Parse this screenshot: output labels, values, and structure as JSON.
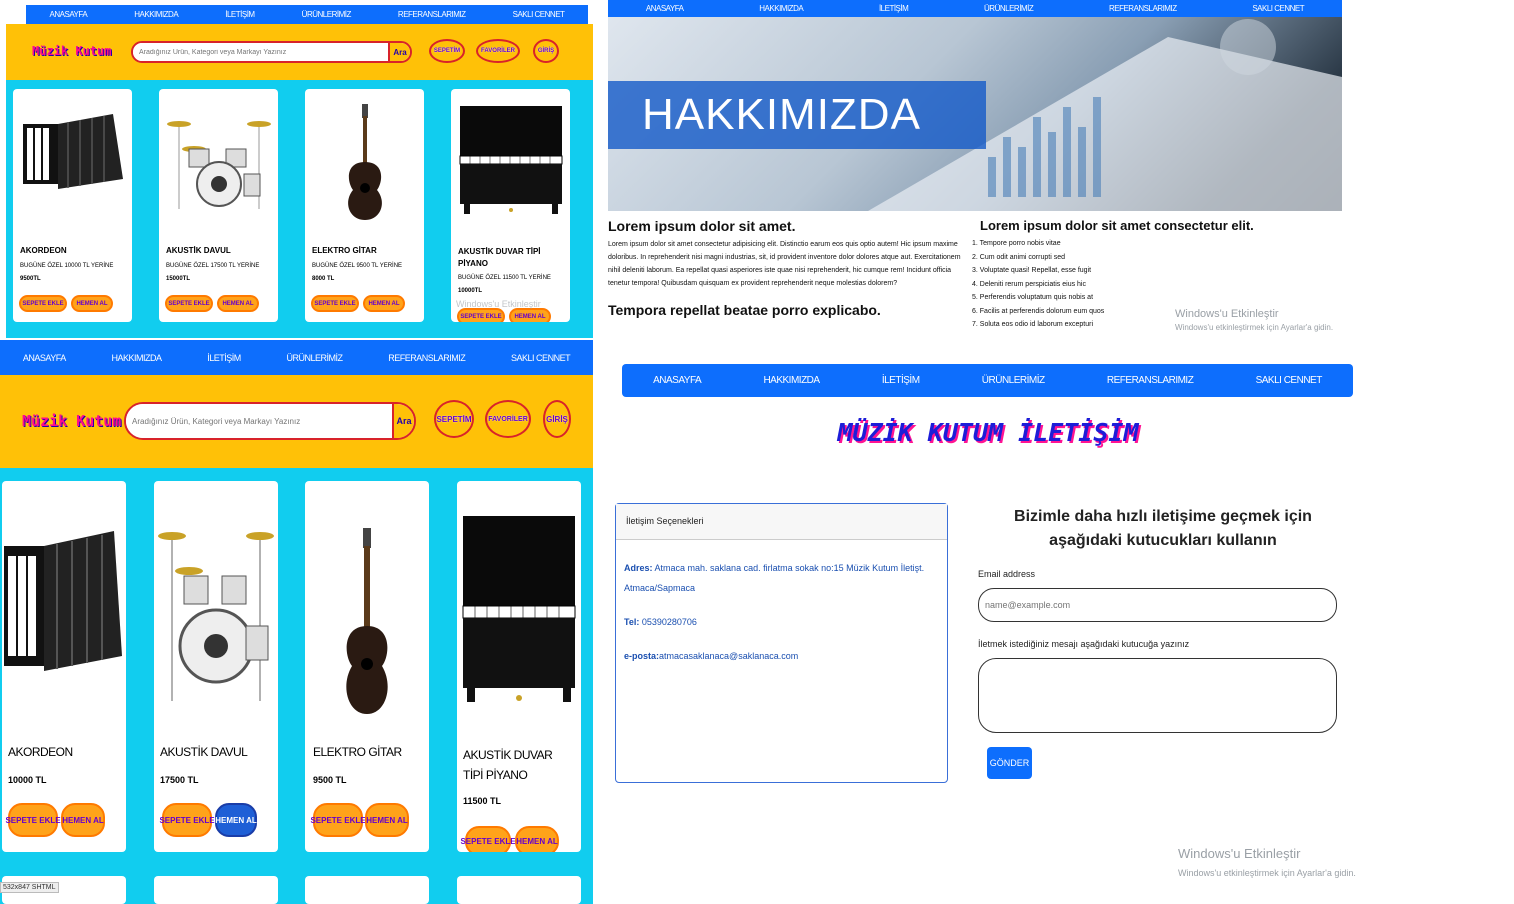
{
  "nav_items": [
    "ANASAYFA",
    "HAKKIMIZDA",
    "İLETİŞİM",
    "ÜRÜNLERİMİZ",
    "REFERANSLARIMIZ",
    "SAKLI CENNET"
  ],
  "shop_small": {
    "logo": "Müzik Kutum",
    "search_placeholder": "Aradığınız Ürün, Kategori veya Markayı Yazınız",
    "search_button": "Ara",
    "buttons": [
      "SEPETİM",
      "FAVORİLER",
      "GİRİŞ"
    ],
    "products": [
      {
        "name": "AKORDEON",
        "price_line": "BUGÜNE ÖZEL 10000 TL YERİNE",
        "price": "9500TL",
        "icon": "accordion-image"
      },
      {
        "name": "AKUSTİK DAVUL",
        "price_line": "BUGÜNE ÖZEL 17500 TL YERİNE",
        "price": "15000TL",
        "icon": "drum-kit-image"
      },
      {
        "name": "ELEKTRO GİTAR",
        "price_line": "BUGÜNE ÖZEL 9500 TL YERİNE",
        "price": "8000 TL",
        "icon": "guitar-image"
      },
      {
        "name": "AKUSTİK DUVAR TİPİ PİYANO",
        "price_line": "BUGÜNE ÖZEL 11500 TL YERİNE",
        "price": "10000TL",
        "icon": "piano-image"
      }
    ],
    "add_to_cart": "SEPETE EKLE",
    "buy_now": "HEMEN AL"
  },
  "about": {
    "hero_title": "HAKKIMIZDA",
    "col1_heading": "Lorem ipsum dolor sit amet.",
    "col1_paragraph": "Lorem ipsum dolor sit amet consectetur adipisicing elit. Distinctio earum eos quis optio autem! Hic ipsum maxime doloribus. In reprehenderit nisi magni industrias, sit, id provident inventore dolor dolores atque aut. Exercitationem nihil deleniti laborum. Ea repellat quasi asperiores iste quae nisi reprehenderit, hic cumque rem! Incidunt officia tenetur tempora! Quibusdam quisquam ex provident reprehenderit neque molestias dolorem?",
    "col1_sub": "Tempora repellat beatae porro explicabo.",
    "col2_heading": "Lorem ipsum dolor sit amet consectetur elit.",
    "col2_list": [
      "1. Tempore porro nobis vitae",
      "2. Cum odit animi corrupti sed",
      "3. Voluptate quasi! Repellat, esse fugit",
      "4. Deleniti rerum perspiciatis eius hic",
      "5. Perferendis voluptatum quis nobis at",
      "6. Facilis at perferendis dolorum eum quos",
      "7. Soluta eos odio id laborum excepturi"
    ]
  },
  "windows_watermark": {
    "title": "Windows'u Etkinleştir",
    "subtitle": "Windows'u etkinleştirmek için Ayarlar'a gidin."
  },
  "shop_large": {
    "logo": "Müzik Kutum",
    "search_placeholder": "Aradığınız Ürün, Kategori veya Markayı Yazınız",
    "search_button": "Ara",
    "buttons": [
      "SEPETİM",
      "FAVORİLER",
      "GİRİŞ"
    ],
    "products": [
      {
        "name": "AKORDEON",
        "price": "10000 TL",
        "icon": "accordion-image"
      },
      {
        "name": "AKUSTİK DAVUL",
        "price": "17500 TL",
        "icon": "drum-kit-image"
      },
      {
        "name": "ELEKTRO GİTAR",
        "price": "9500 TL",
        "icon": "guitar-image"
      },
      {
        "name": "AKUSTİK DUVAR TİPİ PİYANO",
        "price": "11500 TL",
        "icon": "piano-image"
      }
    ],
    "add_to_cart": "SEPETE EKLE",
    "buy_now": "HEMEN AL",
    "status_url": "532x847 SHTML"
  },
  "contact": {
    "title": "MÜZİK KUTUM İLETİŞİM",
    "card_header": "İletişim Seçenekleri",
    "address_label": "Adres:",
    "address_value": "Atmaca mah. saklana cad. firlatma sokak no:15 Müzik Kutum İletişt. Atmaca/Sapmaca",
    "phone_label": "Tel:",
    "phone_value": "05390280706",
    "email_label": "e-posta:",
    "email_value": "atmacasaklanaca@saklanaca.com",
    "form_heading": "Bizimle daha hızlı iletişime geçmek için aşağıdaki kutucukları kullanın",
    "email_field_label": "Email address",
    "email_placeholder": "name@example.com",
    "message_label": "İletmek istediğiniz mesajı aşağıdaki kutucuğa yazınız",
    "submit_label": "GÖNDER"
  },
  "colors": {
    "nav_blue": "#0d6efd",
    "band_yellow": "#ffc107",
    "band_cyan": "#11cdef",
    "btn_orange": "#ffa31a",
    "logo_pink": "#ff0b8c"
  }
}
